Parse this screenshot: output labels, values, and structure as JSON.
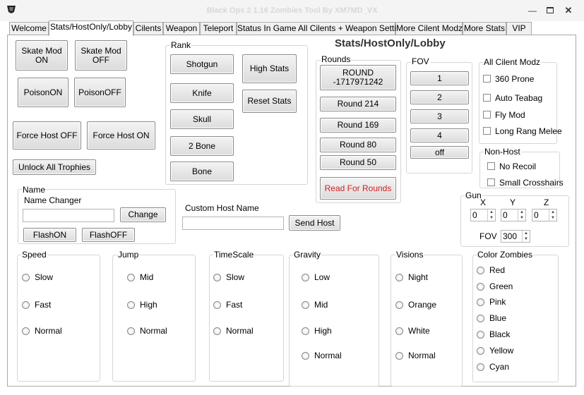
{
  "window": {
    "title": "Black Ops 2 1.16 Zombies Tool By XM7MD_VX"
  },
  "tabs": [
    "Welcome",
    "Stats/HostOnly/Lobby",
    "Cilents",
    "Weapon",
    "Teleport",
    "Status In Game All Cilents + Weapon Setting",
    "More Cilent Modz",
    "More Stats",
    "VIP"
  ],
  "heading": "Stats/HostOnly/Lobby",
  "left_buttons": {
    "skate_on": "Skate Mod\nON",
    "skate_off": "Skate Mod\nOFF",
    "poison_on": "PoisonON",
    "poison_off": "PoisonOFF",
    "force_host_off": "Force Host OFF",
    "force_host_on": "Force Host ON",
    "unlock_trophies": "Unlock All Trophies"
  },
  "rank": {
    "label": "Rank",
    "buttons": [
      "Shotgun",
      "Knife",
      "Skull",
      "2 Bone",
      "Bone"
    ],
    "high_stats": "High Stats",
    "reset_stats": "Reset Stats"
  },
  "rounds": {
    "label": "Rounds",
    "round_value": "ROUND\n-1717971242",
    "buttons": [
      "Round 214",
      "Round 169",
      "Round 80",
      "Round 50"
    ],
    "read": "Read For Rounds",
    "read_color": "#d22222"
  },
  "fov": {
    "label": "FOV",
    "buttons": [
      "1",
      "2",
      "3",
      "4",
      "off"
    ]
  },
  "all_client_modz": {
    "label": "All Cilent Modz",
    "items": [
      "360 Prone",
      "Auto Teabag",
      "Fly Mod",
      "Long Rang Melee"
    ]
  },
  "non_host": {
    "label": "Non-Host",
    "items": [
      "No Recoil",
      "Small Crosshairs"
    ]
  },
  "name": {
    "label": "Name",
    "sub_label": "Name Changer",
    "input_value": "",
    "change": "Change",
    "flash_on": "FlashON",
    "flash_off": "FlashOFF"
  },
  "custom_host": {
    "label": "Custom Host Name",
    "input_value": "",
    "send": "Send Host"
  },
  "gun": {
    "label": "Gun",
    "x_label": "X",
    "y_label": "Y",
    "z_label": "Z",
    "x": "0",
    "y": "0",
    "z": "0",
    "fov_label": "FOV",
    "fov": "300"
  },
  "speed": {
    "label": "Speed",
    "options": [
      "Slow",
      "Fast",
      "Normal"
    ]
  },
  "jump": {
    "label": "Jump",
    "options": [
      "Mid",
      "High",
      "Normal"
    ]
  },
  "timescale": {
    "label": "TimeScale",
    "options": [
      "Slow",
      "Fast",
      "Normal"
    ]
  },
  "gravity": {
    "label": "Gravity",
    "options": [
      "Low",
      "Mid",
      "High",
      "Normal"
    ]
  },
  "visions": {
    "label": "Visions",
    "options": [
      "Night",
      "Orange",
      "White",
      "Normal"
    ]
  },
  "color_zombies": {
    "label": "Color Zombies",
    "options": [
      "Red",
      "Green",
      "Pink",
      "Blue",
      "Black",
      "Yellow",
      "Cyan"
    ]
  }
}
